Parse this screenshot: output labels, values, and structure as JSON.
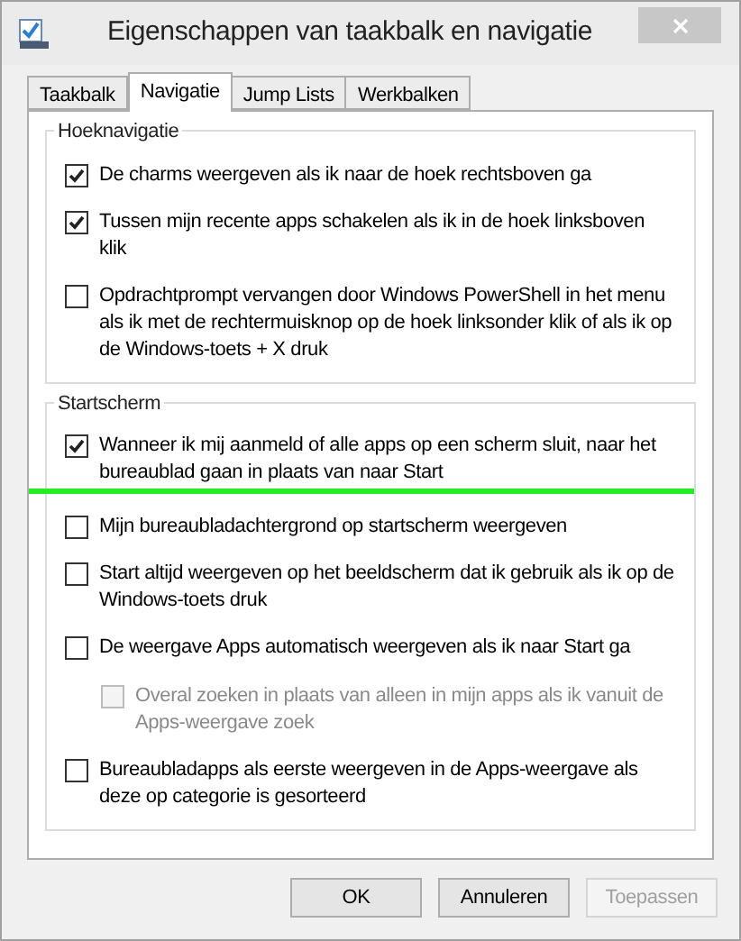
{
  "window": {
    "title": "Eigenschappen van taakbalk en navigatie"
  },
  "tabs": [
    {
      "label": "Taakbalk",
      "selected": false
    },
    {
      "label": "Navigatie",
      "selected": true
    },
    {
      "label": "Jump Lists",
      "selected": false
    },
    {
      "label": "Werkbalken",
      "selected": false
    }
  ],
  "groups": [
    {
      "title": "Hoeknavigatie",
      "options": [
        {
          "label": "De charms weergeven als ik naar de hoek rechtsboven ga",
          "checked": true,
          "disabled": false
        },
        {
          "label": "Tussen mijn recente apps schakelen als ik in de hoek linksboven klik",
          "checked": true,
          "disabled": false
        },
        {
          "label": "Opdrachtprompt vervangen door Windows PowerShell in het menu als ik met de rechtermuisknop op de hoek linksonder klik of als ik op de Windows-toets + X druk",
          "checked": false,
          "disabled": false
        }
      ]
    },
    {
      "title": "Startscherm",
      "options": [
        {
          "label": "Wanneer ik mij aanmeld of alle apps op een scherm sluit, naar het bureaublad gaan in plaats van naar Start",
          "checked": true,
          "disabled": false,
          "highlighted": true
        },
        {
          "label": "Mijn bureaubladachtergrond op startscherm weergeven",
          "checked": false,
          "disabled": false,
          "highlighted": false
        },
        {
          "label": "Start altijd weergeven op het beeldscherm dat ik gebruik als ik op de Windows-toets druk",
          "checked": false,
          "disabled": false,
          "highlighted": false
        },
        {
          "label": "De weergave Apps automatisch weergeven als ik naar Start ga",
          "checked": false,
          "disabled": false,
          "highlighted": false,
          "children": [
            {
              "label": "Overal zoeken in plaats van alleen in mijn apps als ik vanuit de Apps-weergave zoek",
              "checked": false,
              "disabled": true,
              "highlighted": false
            }
          ]
        },
        {
          "label": "Bureaubladapps als eerste weergeven in de Apps-weergave als deze op categorie is gesorteerd",
          "checked": false,
          "disabled": false,
          "highlighted": false
        }
      ]
    }
  ],
  "buttons": [
    {
      "label": "OK",
      "disabled": false
    },
    {
      "label": "Annuleren",
      "disabled": false
    },
    {
      "label": "Toepassen",
      "disabled": true
    }
  ]
}
